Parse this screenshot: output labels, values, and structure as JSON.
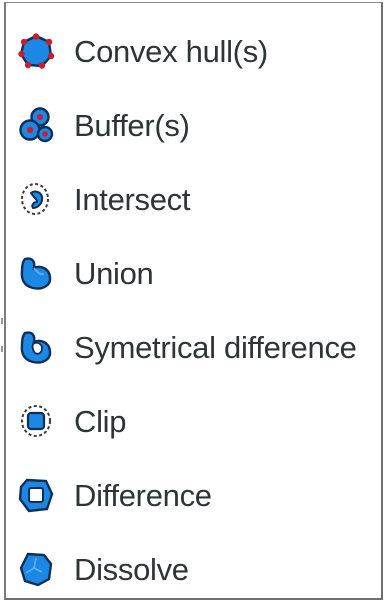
{
  "menu": {
    "items": [
      {
        "label": "Convex hull(s)",
        "icon": "convex-hull-icon"
      },
      {
        "label": "Buffer(s)",
        "icon": "buffer-icon"
      },
      {
        "label": "Intersect",
        "icon": "intersect-icon"
      },
      {
        "label": "Union",
        "icon": "union-icon"
      },
      {
        "label": "Symetrical difference",
        "icon": "symetrical-difference-icon"
      },
      {
        "label": "Clip",
        "icon": "clip-icon"
      },
      {
        "label": "Difference",
        "icon": "difference-icon"
      },
      {
        "label": "Dissolve",
        "icon": "dissolve-icon"
      }
    ]
  },
  "colors": {
    "icon_blue": "#1d87e4",
    "icon_dark": "#0f2f57",
    "vertex_red": "#c81e2b",
    "text": "#2f3437",
    "border": "#8a8a8a"
  }
}
